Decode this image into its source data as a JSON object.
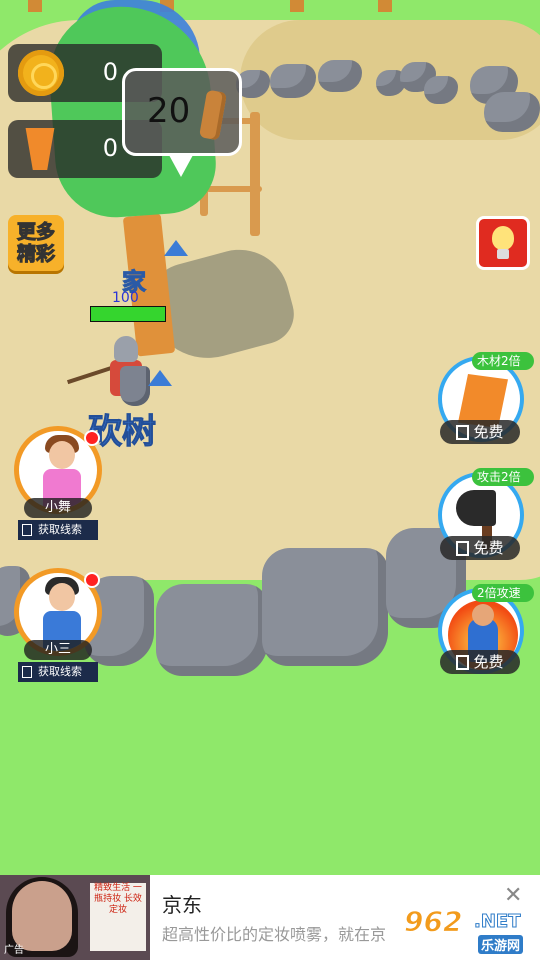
{
  "resources": {
    "coins": "0",
    "wood": "0"
  },
  "tree_bubble": {
    "wood_required": "20"
  },
  "buttons": {
    "more_fun_line1": "更多",
    "more_fun_line2": "精彩"
  },
  "scene_labels": {
    "home": "家",
    "chop_tree": "砍树"
  },
  "player": {
    "hp": "100",
    "hp_fraction": 1.0
  },
  "npcs": [
    {
      "name": "小舞",
      "action": "获取线索"
    },
    {
      "name": "小三",
      "action": "获取线索"
    }
  ],
  "boosts": [
    {
      "tag": "木材2倍",
      "button": "免费",
      "icon": "wood-icon"
    },
    {
      "tag": "攻击2倍",
      "button": "免费",
      "icon": "axe-icon"
    },
    {
      "tag": "2倍攻速",
      "button": "免费",
      "icon": "fire-strongman-icon"
    }
  ],
  "ad": {
    "title": "京东",
    "description": "超高性价比的定妆喷雾，就在京",
    "tag": "广告",
    "image_text": "精致生活 一瓶持妆 长效定妆"
  },
  "watermark": {
    "number": "962",
    "net": ".NET",
    "site_name": "乐游网"
  },
  "colors": {
    "grass": "#8fe86a",
    "sand": "#e9d9a6",
    "label_blue": "#3b7cd6",
    "boost_tag_green": "#3cc23d",
    "hp_green": "#35d52e"
  }
}
